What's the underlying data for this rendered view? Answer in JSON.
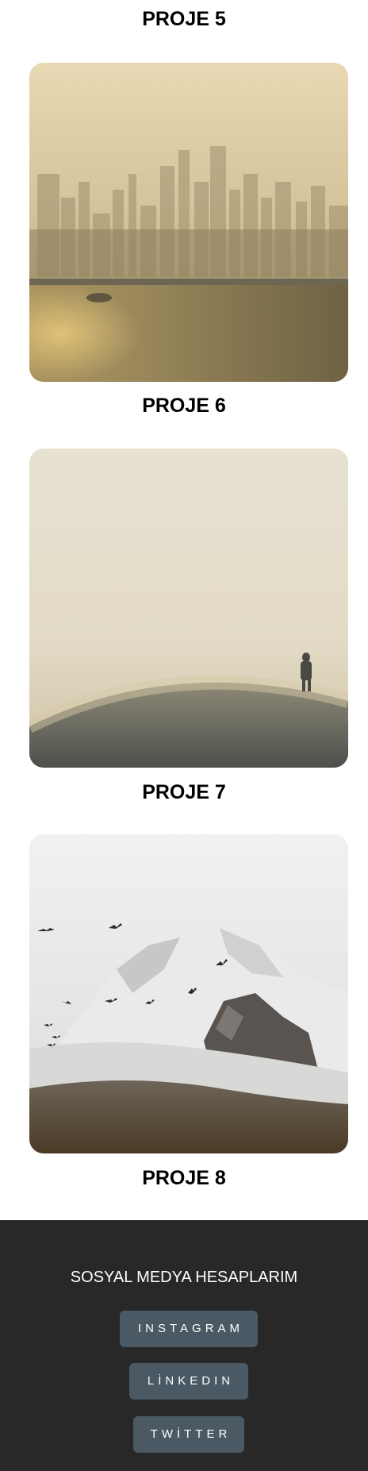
{
  "projects": [
    {
      "title": "PROJE 5",
      "image": "hazy-city-skyline-photo"
    },
    {
      "title": "PROJE 6",
      "image": "foggy-hill-figure-photo"
    },
    {
      "title": "PROJE 7",
      "image": "snowy-mountain-birds-photo"
    },
    {
      "title": "PROJE 8"
    }
  ],
  "footer": {
    "heading": "SOSYAL MEDYA HESAPLARIM",
    "buttons": [
      {
        "label": "INSTAGRAM"
      },
      {
        "label": "LİNKEDIN"
      },
      {
        "label": "TWİTTER"
      }
    ],
    "background": "#282828",
    "button_color": "#4a5963"
  }
}
